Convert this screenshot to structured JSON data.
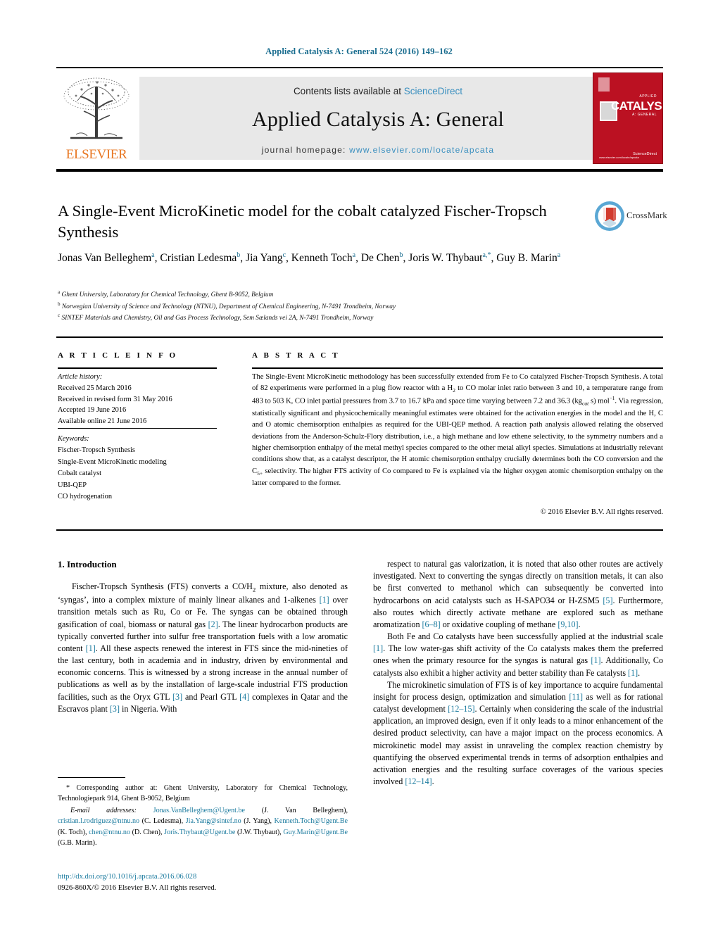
{
  "running_head": "Applied Catalysis A: General 524 (2016) 149–162",
  "masthead": {
    "contents_prefix": "Contents lists available at ",
    "sciencedirect": "ScienceDirect",
    "journal_title": "Applied Catalysis A: General",
    "homepage_prefix": "journal homepage: ",
    "homepage_url": "www.elsevier.com/locate/apcata",
    "publisher": "ELSEVIER",
    "cover": {
      "title": "CATALYSIS",
      "sub_top": "APPLIED",
      "sub_bottom": "A: GENERAL",
      "sciencedirect": "ScienceDirect",
      "issn": "www.elsevier.com/locate/apcata"
    },
    "accent_color": "#3a8fbf",
    "cover_color": "#bb1122",
    "elsevier_color": "#e87722"
  },
  "crossmark": {
    "label": "CrossMark"
  },
  "article": {
    "title": "A Single-Event MicroKinetic model for the cobalt catalyzed Fischer-Tropsch Synthesis",
    "authors_html": "Jonas Van Belleghem<sup>a</sup>, Cristian Ledesma<sup>b</sup>, Jia Yang<sup>c</sup>, Kenneth Toch<sup>a</sup>, De Chen<sup>b</sup>, Joris W. Thybaut<sup>a,*</sup>, Guy B. Marin<sup>a</sup>",
    "affiliations": [
      {
        "marker": "a",
        "text": "Ghent University, Laboratory for Chemical Technology, Ghent B-9052, Belgium"
      },
      {
        "marker": "b",
        "text": "Norwegian University of Science and Technology (NTNU), Department of Chemical Engineering, N-7491 Trondheim, Norway"
      },
      {
        "marker": "c",
        "text": "SINTEF Materials and Chemistry, Oil and Gas Process Technology, Sem Sælands vei 2A, N-7491 Trondheim, Norway"
      }
    ]
  },
  "article_info": {
    "heading": "A R T I C L E   I N F O",
    "history_label": "Article history:",
    "history": [
      "Received 25 March 2016",
      "Received in revised form 31 May 2016",
      "Accepted 19 June 2016",
      "Available online 21 June 2016"
    ],
    "keywords_label": "Keywords:",
    "keywords": [
      "Fischer-Tropsch Synthesis",
      "Single-Event MicroKinetic modeling",
      "Cobalt catalyst",
      "UBI-QEP",
      "CO hydrogenation"
    ]
  },
  "abstract": {
    "heading": "A B S T R A C T",
    "text_html": "The Single-Event MicroKinetic methodology has been successfully extended from Fe to Co catalyzed Fischer-Tropsch Synthesis. A total of 82 experiments were performed in a plug flow reactor with a H<sub>2</sub> to CO molar inlet ratio between 3 and 10, a temperature range from 483 to 503 K, CO inlet partial pressures from 3.7 to 16.7 kPa and space time varying between 7.2 and 36.3 (kg<sub><i>cat</i></sub> s) mol<sup class=\"sm\">−1</sup>. Via regression, statistically significant and physicochemically meaningful estimates were obtained for the activation energies in the model and the H, C and O atomic chemisorption enthalpies as required for the UBI-QEP method. A reaction path analysis allowed relating the observed deviations from the Anderson-Schulz-Flory distribution, i.e., a high methane and low ethene selectivity, to the symmetry numbers and a higher chemisorption enthalpy of the metal methyl species compared to the other metal alkyl species. Simulations at industrially relevant conditions show that, as a catalyst descriptor, the H atomic chemisorption enthalpy crucially determines both the CO conversion and the C<sub>5+</sub> selectivity. The higher FTS activity of Co compared to Fe is explained via the higher oxygen atomic chemisorption enthalpy on the latter compared to the former.",
    "copyright": "© 2016 Elsevier B.V. All rights reserved."
  },
  "body": {
    "section_number_title": "1.  Introduction",
    "left_paragraphs_html": [
      "Fischer-Tropsch Synthesis (FTS) converts a CO/H<sub>2</sub> mixture, also denoted as ‘syngas’, into a complex mixture of mainly linear alkanes and 1-alkenes <span class=\"ref\">[1]</span> over transition metals such as Ru, Co or Fe. The syngas can be obtained through gasification of coal, biomass or natural gas <span class=\"ref\">[2]</span>. The linear hydrocarbon products are typically converted further into sulfur free transportation fuels with a low aromatic content <span class=\"ref\">[1]</span>. All these aspects renewed the interest in FTS since the mid-nineties of the last century, both in academia and in industry, driven by environmental and economic concerns. This is witnessed by a strong increase in the annual number of publications as well as by the installation of large-scale industrial FTS production facilities, such as the Oryx GTL <span class=\"ref\">[3]</span> and Pearl GTL <span class=\"ref\">[4]</span> complexes in Qatar and the Escravos plant <span class=\"ref\">[3]</span> in Nigeria. With"
    ],
    "right_paragraphs_html": [
      "respect to natural gas valorization, it is noted that also other routes are actively investigated. Next to converting the syngas directly on transition metals, it can also be first converted to methanol which can subsequently be converted into hydrocarbons on acid catalysts such as H-SAPO34 or H-ZSM5 <span class=\"ref\">[5]</span>. Furthermore, also routes which directly activate methane are explored such as methane aromatization <span class=\"ref\">[6–8]</span> or oxidative coupling of methane <span class=\"ref\">[9,10]</span>.",
      "Both Fe and Co catalysts have been successfully applied at the industrial scale <span class=\"ref\">[1]</span>. The low water-gas shift activity of the Co catalysts makes them the preferred ones when the primary resource for the syngas is natural gas <span class=\"ref\">[1]</span>. Additionally, Co catalysts also exhibit a higher activity and better stability than Fe catalysts <span class=\"ref\">[1]</span>.",
      "The microkinetic simulation of FTS is of key importance to acquire fundamental insight for process design, optimization and simulation <span class=\"ref\">[11]</span> as well as for rational catalyst development <span class=\"ref\">[12–15]</span>. Certainly when considering the scale of the industrial application, an improved design, even if it only leads to a minor enhancement of the desired product selectivity, can have a major impact on the process economics. A microkinetic model may assist in unraveling the complex reaction chemistry by quantifying the observed experimental trends in terms of adsorption enthalpies and activation energies and the resulting surface coverages of the various species involved <span class=\"ref\">[12–14]</span>."
    ]
  },
  "footnotes": {
    "corresponding_html": "* Corresponding author at: Ghent University, Laboratory for Chemical Technology, Technologiepark 914, Ghent B-9052, Belgium",
    "email_html": "<span class=\"ital\">E-mail addresses:</span> <span class=\"link\">Jonas.VanBelleghem@Ugent.be</span> (J. Van Belleghem), <span class=\"link\">cristian.l.rodriguez@ntnu.no</span> (C. Ledesma), <span class=\"link\">Jia.Yang@sintef.no</span> (J. Yang), <span class=\"link\">Kenneth.Toch@Ugent.Be</span> (K. Toch), <span class=\"link\">chen@ntnu.no</span> (D. Chen), <span class=\"link\">Joris.Thybaut@Ugent.be</span> (J.W. Thybaut), <span class=\"link\">Guy.Marin@Ugent.Be</span> (G.B. Marin)."
  },
  "doi_block": {
    "doi": "http://dx.doi.org/10.1016/j.apcata.2016.06.028",
    "issn_line": "0926-860X/© 2016 Elsevier B.V. All rights reserved."
  }
}
